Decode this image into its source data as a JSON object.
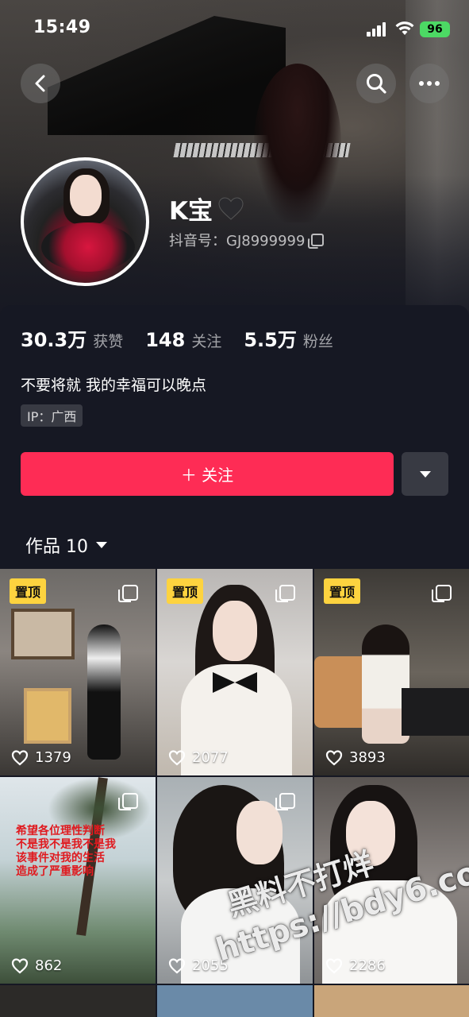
{
  "status_bar": {
    "time": "15:49",
    "battery": "96"
  },
  "profile": {
    "nickname": "K宝",
    "douyin_id": "抖音号：GJ8999999",
    "bio": "不要将就 我的幸福可以晚点",
    "ip": "IP：广西"
  },
  "stats": [
    {
      "value": "30.3万",
      "label": "获赞"
    },
    {
      "value": "148",
      "label": "关注"
    },
    {
      "value": "5.5万",
      "label": "粉丝"
    }
  ],
  "actions": {
    "follow_label": "＋ 关注"
  },
  "works_tab": {
    "label": "作品 10"
  },
  "grid": [
    {
      "pinned": "置顶",
      "likes": "1379",
      "multi": true
    },
    {
      "pinned": "置顶",
      "likes": "2077",
      "multi": true
    },
    {
      "pinned": "置顶",
      "likes": "3893",
      "multi": true
    },
    {
      "pinned": "",
      "likes": "862",
      "multi": true,
      "overlay_text": "希望各位理性判断\n不是我不是我不是我\n该事件对我的生活\n造成了严重影响"
    },
    {
      "pinned": "",
      "likes": "2055",
      "multi": true
    },
    {
      "pinned": "",
      "likes": "2286",
      "multi": false
    }
  ],
  "watermark": {
    "line1": "黑料不打烊",
    "line2": "https://bdy6.co"
  },
  "colors": {
    "accent": "#fe2c55",
    "background": "#161823",
    "pin_badge": "#fdd33f"
  }
}
